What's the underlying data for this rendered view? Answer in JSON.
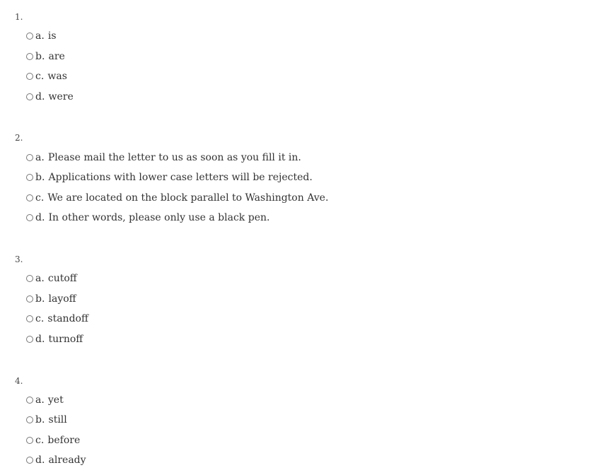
{
  "questions": [
    {
      "number": "1.",
      "options": [
        {
          "letter": "a.",
          "text": "is"
        },
        {
          "letter": "b.",
          "text": "are"
        },
        {
          "letter": "c.",
          "text": "was"
        },
        {
          "letter": "d.",
          "text": "were"
        }
      ]
    },
    {
      "number": "2.",
      "options": [
        {
          "letter": "a.",
          "text": "Please mail the letter to us as soon as you fill it in."
        },
        {
          "letter": "b.",
          "text": "Applications with lower case letters will be rejected."
        },
        {
          "letter": "c.",
          "text": "We are located on the block parallel to Washington Ave."
        },
        {
          "letter": "d.",
          "text": "In other words, please only use a black pen."
        }
      ]
    },
    {
      "number": "3.",
      "options": [
        {
          "letter": "a.",
          "text": "cutoff"
        },
        {
          "letter": "b.",
          "text": "layoff"
        },
        {
          "letter": "c.",
          "text": "standoff"
        },
        {
          "letter": "d.",
          "text": "turnoff"
        }
      ]
    },
    {
      "number": "4.",
      "options": [
        {
          "letter": "a.",
          "text": "yet"
        },
        {
          "letter": "b.",
          "text": "still"
        },
        {
          "letter": "c.",
          "text": "before"
        },
        {
          "letter": "d.",
          "text": "already"
        }
      ]
    }
  ]
}
